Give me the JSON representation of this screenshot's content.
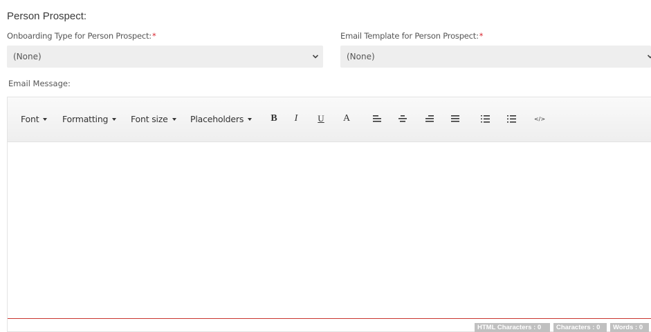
{
  "section": {
    "title": "Person Prospect:"
  },
  "onboarding": {
    "label": "Onboarding Type for Person Prospect:",
    "required_mark": "*",
    "value": "(None)"
  },
  "email_template": {
    "label": "Email Template for Person Prospect:",
    "required_mark": "*",
    "value": "(None)"
  },
  "email_message": {
    "label": "Email Message:"
  },
  "toolbar": {
    "font": "Font",
    "formatting": "Formatting",
    "font_size": "Font size",
    "placeholders": "Placeholders",
    "bold": "B",
    "italic": "I",
    "underline": "U",
    "font_color": "A",
    "code": "</>"
  },
  "status": {
    "html_chars": "HTML Characters : 0",
    "chars": "Characters : 0",
    "words": "Words : 0"
  },
  "colors": {
    "required": "#d9262f",
    "divider": "#c9342d",
    "status_bg": "#c0c0c0"
  }
}
